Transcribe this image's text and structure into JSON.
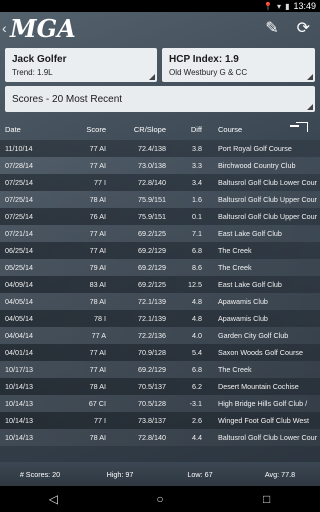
{
  "status": {
    "time": "13:49"
  },
  "appbar": {
    "logo": "MGA",
    "back_icon": "chevron-left-icon",
    "edit_icon": "pencil-icon",
    "refresh_icon": "refresh-icon"
  },
  "player": {
    "name": "Jack Golfer",
    "trend": "Trend: 1.9L"
  },
  "hcp": {
    "index": "HCP Index: 1.9",
    "club": "Old Westbury G & CC"
  },
  "scores_select": {
    "selected": "Scores - 20 Most Recent"
  },
  "table": {
    "headers": {
      "date": "Date",
      "score": "Score",
      "cr": "CR/Slope",
      "diff": "Diff",
      "course": "Course"
    },
    "rows": [
      {
        "date": "11/10/14",
        "score": "77 AI",
        "cr": "72.4/138",
        "diff": "3.8",
        "course": "Port Royal Golf Course"
      },
      {
        "date": "07/28/14",
        "score": "77 AI",
        "cr": "73.0/138",
        "diff": "3.3",
        "course": "Birchwood Country Club"
      },
      {
        "date": "07/25/14",
        "score": "77 I",
        "cr": "72.8/140",
        "diff": "3.4",
        "course": "Baltusrol Golf Club Lower Cour"
      },
      {
        "date": "07/25/14",
        "score": "78 AI",
        "cr": "75.9/151",
        "diff": "1.6",
        "course": "Baltusrol Golf Club Upper Cour"
      },
      {
        "date": "07/25/14",
        "score": "76 AI",
        "cr": "75.9/151",
        "diff": "0.1",
        "course": "Baltusrol Golf Club Upper Cour"
      },
      {
        "date": "07/21/14",
        "score": "77 AI",
        "cr": "69.2/125",
        "diff": "7.1",
        "course": "East Lake Golf Club"
      },
      {
        "date": "06/25/14",
        "score": "77 AI",
        "cr": "69.2/129",
        "diff": "6.8",
        "course": "The Creek"
      },
      {
        "date": "05/25/14",
        "score": "79 AI",
        "cr": "69.2/129",
        "diff": "8.6",
        "course": "The Creek"
      },
      {
        "date": "04/09/14",
        "score": "83 AI",
        "cr": "69.2/125",
        "diff": "12.5",
        "course": "East Lake Golf Club"
      },
      {
        "date": "04/05/14",
        "score": "78 AI",
        "cr": "72.1/139",
        "diff": "4.8",
        "course": "Apawamis Club"
      },
      {
        "date": "04/05/14",
        "score": "78 I",
        "cr": "72.1/139",
        "diff": "4.8",
        "course": "Apawamis Club"
      },
      {
        "date": "04/04/14",
        "score": "77 A",
        "cr": "72.2/136",
        "diff": "4.0",
        "course": "Garden City Golf Club"
      },
      {
        "date": "04/01/14",
        "score": "77 AI",
        "cr": "70.9/128",
        "diff": "5.4",
        "course": "Saxon Woods Golf Course"
      },
      {
        "date": "10/17/13",
        "score": "77 AI",
        "cr": "69.2/129",
        "diff": "6.8",
        "course": "The Creek"
      },
      {
        "date": "10/14/13",
        "score": "78 AI",
        "cr": "70.5/137",
        "diff": "6.2",
        "course": "Desert Mountain Cochise"
      },
      {
        "date": "10/14/13",
        "score": "67 CI",
        "cr": "70.5/128",
        "diff": "-3.1",
        "course": "High Bridge Hills Golf Club /"
      },
      {
        "date": "10/14/13",
        "score": "77 I",
        "cr": "73.8/137",
        "diff": "2.6",
        "course": "Winged Foot Golf Club West"
      },
      {
        "date": "10/14/13",
        "score": "78 AI",
        "cr": "72.8/140",
        "diff": "4.4",
        "course": "Baltusrol Golf Club Lower Cour"
      }
    ]
  },
  "footer": {
    "count": "# Scores: 20",
    "high": "High: 97",
    "low": "Low: 67",
    "avg": "Avg: 77.8"
  },
  "nav": {
    "back": "back-triangle-icon",
    "home": "home-circle-icon",
    "recents": "recents-square-icon"
  }
}
